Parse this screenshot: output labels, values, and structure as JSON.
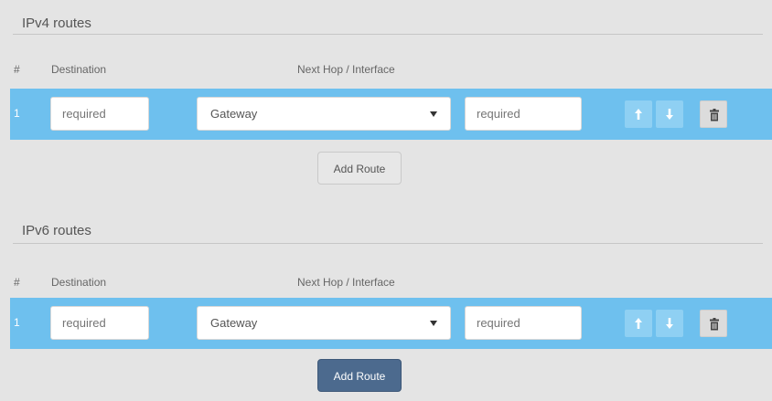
{
  "ipv4": {
    "title": "IPv4 routes",
    "columns": {
      "num": "#",
      "destination": "Destination",
      "next_hop": "Next Hop / Interface"
    },
    "row": {
      "num": "1",
      "destination_placeholder": "required",
      "next_hop_type": "Gateway",
      "next_hop_placeholder": "required"
    },
    "add_route_label": "Add Route"
  },
  "ipv6": {
    "title": "IPv6 routes",
    "columns": {
      "num": "#",
      "destination": "Destination",
      "next_hop": "Next Hop / Interface"
    },
    "row": {
      "num": "1",
      "destination_placeholder": "required",
      "next_hop_type": "Gateway",
      "next_hop_placeholder": "required"
    },
    "add_route_label": "Add Route"
  },
  "colors": {
    "row_highlight": "#6ec0ee",
    "primary_button": "#4c6a8e"
  },
  "icons": [
    "arrow-up-icon",
    "arrow-down-icon",
    "trash-icon"
  ]
}
